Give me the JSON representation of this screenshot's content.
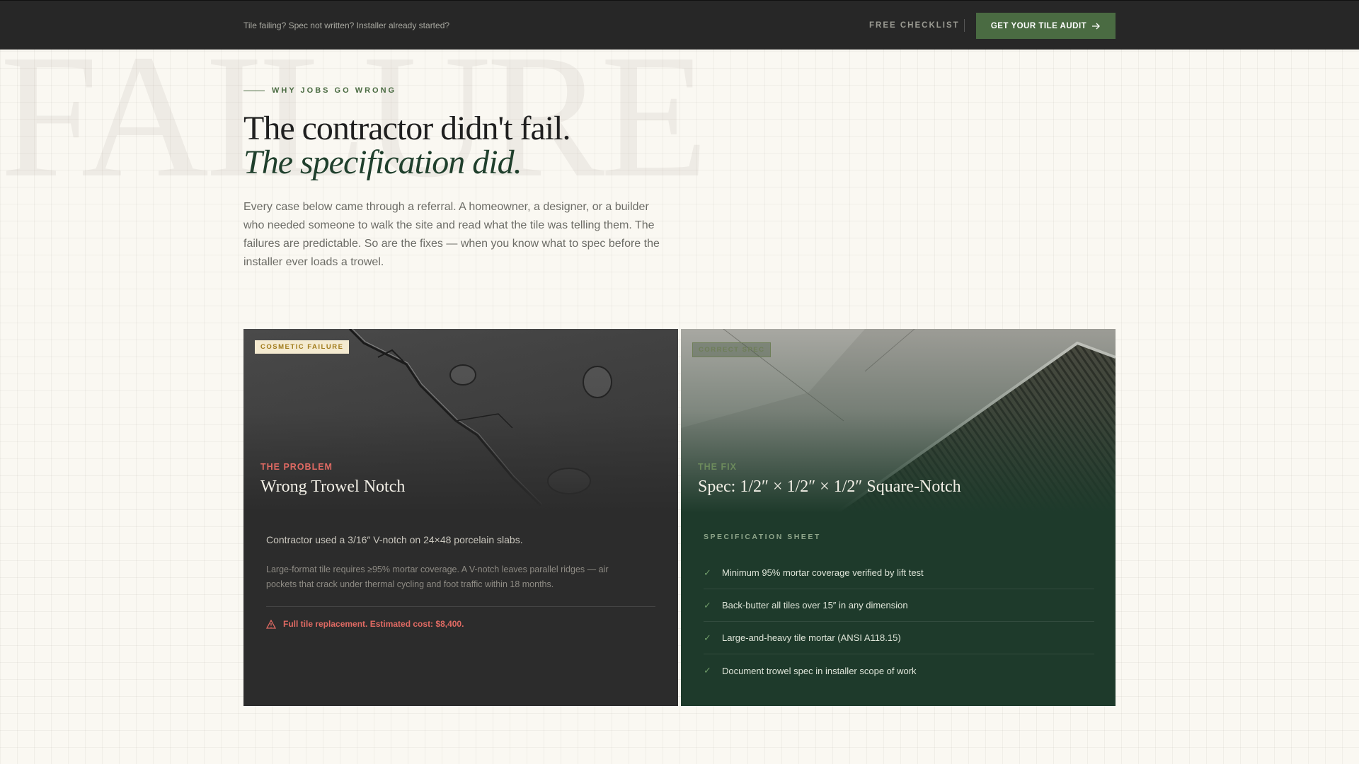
{
  "topbar": {
    "tagline": "Tile failing? Spec not written? Installer already started?",
    "checklist_link": "FREE CHECKLIST",
    "audit_button": "GET YOUR TILE AUDIT",
    "audit_icon": "arrow-right-icon"
  },
  "watermark": "FAILURE",
  "hero": {
    "eyebrow": "WHY JOBS GO WRONG",
    "title_line1": "The contractor didn't fail.",
    "title_line2": "The specification did.",
    "intro": "Every case below came through a referral. A homeowner, a designer, or a builder who needed someone to walk the site and read what the tile was telling them. The failures are predictable. So are the fixes — when you know what to spec before the installer ever loads a trowel."
  },
  "problem_card": {
    "badge": "COSMETIC FAILURE",
    "label": "THE PROBLEM",
    "title": "Wrong Trowel Notch",
    "lead": "Contractor used a 3/16″ V-notch on 24×48 porcelain slabs.",
    "detail": "Large-format tile requires ≥95% mortar coverage. A V-notch leaves parallel ridges — air pockets that crack under thermal cycling and foot traffic within 18 months.",
    "warning": "Full tile replacement. Estimated cost: $8,400.",
    "warning_icon": "warning-triangle-icon"
  },
  "fix_card": {
    "badge": "CORRECT SPEC",
    "label": "THE FIX",
    "title": "Spec: 1/2″ × 1/2″ × 1/2″ Square-Notch",
    "specs_title": "SPECIFICATION SHEET",
    "check_icon": "check-icon",
    "specs": [
      "Minimum 95% mortar coverage verified by lift test",
      "Back-butter all tiles over 15″ in any dimension",
      "Large-and-heavy tile mortar (ANSI A118.15)",
      "Document trowel spec in installer scope of work"
    ]
  },
  "colors": {
    "accent": "#4a6b42",
    "problem_red": "#e06a63",
    "fix_green": "#1e3a2b",
    "dark_bar": "#272727"
  }
}
